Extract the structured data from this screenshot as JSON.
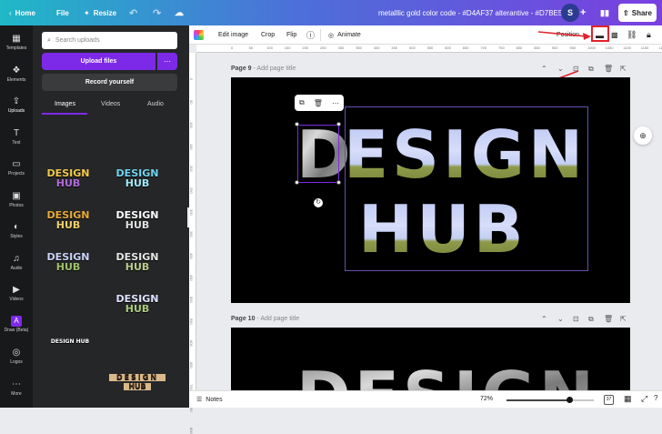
{
  "topbar": {
    "home": "Home",
    "file": "File",
    "resize": "Resize",
    "title": "metalllic gold color code - #D4AF37 alterantive - #D7BE59",
    "avatar_initial": "S",
    "share": "Share"
  },
  "rail": [
    {
      "label": "Templates",
      "icon": "template-icon",
      "glyph": "▦"
    },
    {
      "label": "Elements",
      "icon": "elements-icon",
      "glyph": "❖"
    },
    {
      "label": "Uploads",
      "icon": "upload-icon",
      "glyph": "⇪"
    },
    {
      "label": "Text",
      "icon": "text-icon",
      "glyph": "T"
    },
    {
      "label": "Projects",
      "icon": "folder-icon",
      "glyph": "▭"
    },
    {
      "label": "Photos",
      "icon": "photo-icon",
      "glyph": "▣"
    },
    {
      "label": "Styles",
      "icon": "styles-icon",
      "glyph": "◐"
    },
    {
      "label": "Audio",
      "icon": "audio-icon",
      "glyph": "♫"
    },
    {
      "label": "Videos",
      "icon": "video-icon",
      "glyph": "▶"
    },
    {
      "label": "Draw (Beta)",
      "icon": "draw-icon",
      "glyph": "A"
    },
    {
      "label": "Logos",
      "icon": "logo-icon",
      "glyph": "◎"
    },
    {
      "label": "More",
      "icon": "more-icon",
      "glyph": "⋯"
    }
  ],
  "panel": {
    "search_placeholder": "Search uploads",
    "upload_files": "Upload files",
    "record": "Record yourself",
    "tabs": [
      "Images",
      "Videos",
      "Audio"
    ],
    "thumbs": [
      {
        "l1": "DESIGN",
        "l2": "HUB",
        "c1": "#f2c94c",
        "c2": "#b06bd8"
      },
      {
        "l1": "DESIGN",
        "l2": "HUB",
        "c1": "#6fd3f0",
        "c2": "#9fe7f7"
      },
      {
        "l1": "DESIGN",
        "l2": "HUB",
        "c1": "#e8a93a",
        "c2": "#f0d06a"
      },
      {
        "l1": "DESIGN",
        "l2": "HUB",
        "c1": "#ffffff",
        "c2": "#e0e0e0"
      },
      {
        "l1": "DESIGN",
        "l2": "HUB",
        "c1": "#c9d3f6",
        "c2": "#9fbf6a"
      },
      {
        "l1": "DESIGN",
        "l2": "HUB",
        "c1": "#e6e6e6",
        "c2": "#b8c98a"
      },
      {
        "l1": "DESIGN",
        "l2": "HUB",
        "c1": "#dde2ff",
        "c2": "#a9c97a"
      },
      {
        "l1": "DESIGN HUB",
        "l2": "",
        "c1": "#ffffff",
        "c2": "#ffffff"
      },
      {
        "l1": "DESIGN",
        "l2": "HUB",
        "c1": "#e9c9a0",
        "c2": "#e9c9a0"
      }
    ]
  },
  "toolbar": {
    "edit_image": "Edit image",
    "crop": "Crop",
    "flip": "Flip",
    "animate": "Animate",
    "position": "Position"
  },
  "ruler_ticks": [
    "0",
    "50",
    "100",
    "150",
    "200",
    "250",
    "300",
    "350",
    "400",
    "450",
    "500",
    "550",
    "600",
    "650",
    "700",
    "750",
    "800",
    "850",
    "900",
    "950",
    "1000",
    "1050",
    "1100",
    "1150",
    "1200",
    "1250"
  ],
  "vruler_ticks": [
    "0",
    "50",
    "100",
    "150",
    "200",
    "250",
    "300",
    "350",
    "400",
    "450",
    "500",
    "550",
    "600",
    "650",
    "700",
    "750",
    "800"
  ],
  "page9": {
    "label": "Page 9",
    "sep": " - ",
    "add_title": "Add page title",
    "word1": "DESIGN",
    "word2": "HUB",
    "word1_left": "D",
    "word1_rest": "ESIGN"
  },
  "page10": {
    "label": "Page 10",
    "sep": " - ",
    "add_title": "Add page title",
    "word": "DESIGN"
  },
  "bottom": {
    "notes": "Notes",
    "zoom": "72%",
    "zoom_level": 0.72,
    "page_count": "37"
  },
  "colors": {
    "brand_purple": "#7d2ae8",
    "annotation_red": "#e3222a"
  }
}
